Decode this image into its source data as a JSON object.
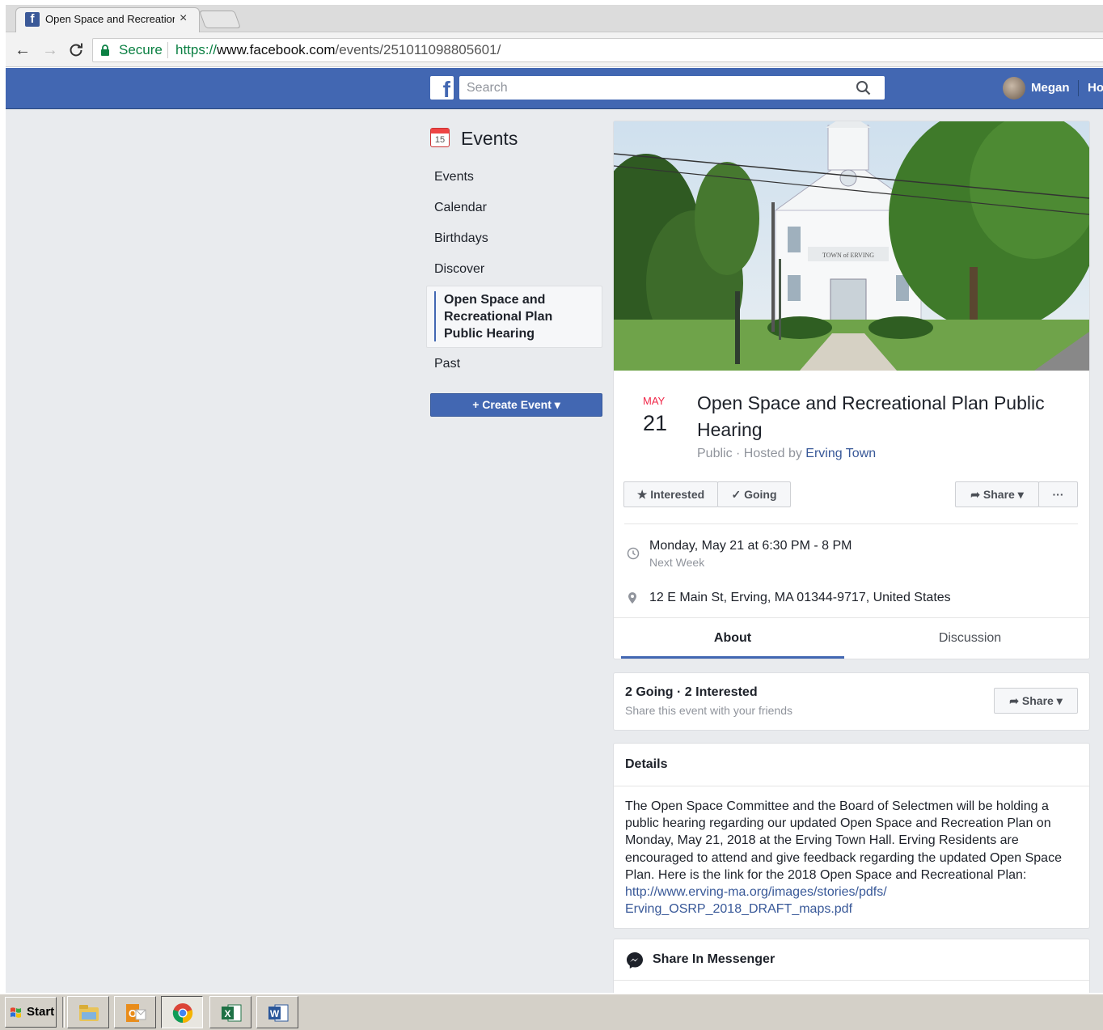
{
  "browser": {
    "tab_title": "Open Space and Recreation",
    "tab_close": "×",
    "secure_label": "Secure",
    "url_protocol": "https://",
    "url_host": "www.facebook.com",
    "url_path": "/events/251011098805601/"
  },
  "header": {
    "logo": "f",
    "search_placeholder": "Search",
    "username": "Megan",
    "home_label": "Home"
  },
  "sidebar": {
    "heading": "Events",
    "calendar_day": "15",
    "items": [
      {
        "label": "Events"
      },
      {
        "label": "Calendar"
      },
      {
        "label": "Birthdays"
      },
      {
        "label": "Discover"
      },
      {
        "label": "Open Space and Recreational Plan Public Hearing"
      },
      {
        "label": "Past"
      }
    ],
    "create_label": "+ Create Event ▾"
  },
  "event": {
    "month": "MAY",
    "day": "21",
    "title": "Open Space and Recreational Plan Public Hearing",
    "privacy": "Public",
    "hosted_by_prefix": "Hosted by",
    "host": "Erving Town",
    "cover_sign": "TOWN of ERVING",
    "buttons": {
      "interested": "Interested",
      "going": "Going",
      "share": "Share",
      "more": "···"
    },
    "time": "Monday, May 21 at 6:30 PM - 8 PM",
    "relative": "Next Week",
    "address": "12 E Main St, Erving, MA 01344-9717, United States",
    "tabs": {
      "about": "About",
      "discussion": "Discussion"
    }
  },
  "stats": {
    "title": "2 Going · 2 Interested",
    "subtitle": "Share this event with your friends",
    "share": "Share"
  },
  "details": {
    "title": "Details",
    "body": "The Open Space Committee and the Board of Selectmen will be holding a public hearing regarding our updated Open Space and Recreation Plan on Monday, May 21, 2018 at the Erving Town Hall. Erving Residents are encouraged to attend and give feedback regarding the updated Open Space Plan. Here is the link for the 2018 Open Space and Recreational Plan:",
    "link_line1": "http://www.erving-ma.org/images/stories/pdfs/",
    "link_line2": "Erving_OSRP_2018_DRAFT_maps.pdf"
  },
  "messenger": {
    "label": "Share In Messenger"
  },
  "taskbar": {
    "start_label": "Start",
    "apps": [
      "file-explorer",
      "outlook",
      "chrome",
      "excel",
      "word"
    ]
  },
  "colors": {
    "fb_blue": "#4267b2",
    "link": "#385898",
    "month_red": "#f02849",
    "page_bg": "#e9ebee"
  }
}
